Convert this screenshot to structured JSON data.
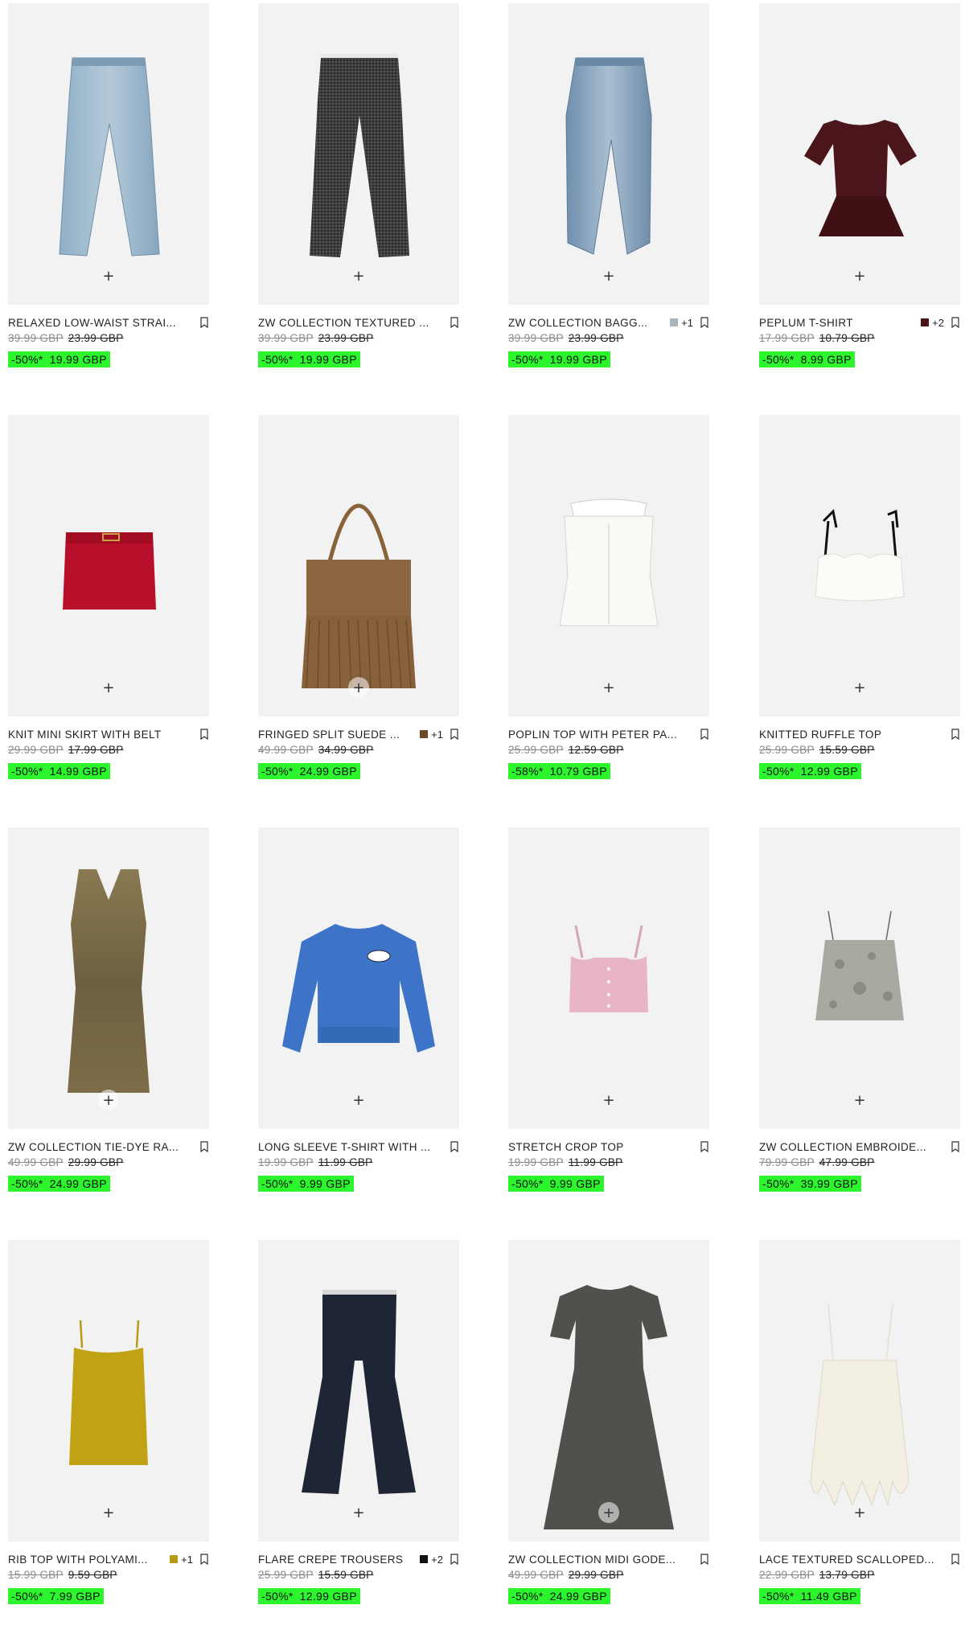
{
  "colors": {
    "sale_badge": "#2df52d",
    "image_bg": "#f2f2f2"
  },
  "products": [
    {
      "name": "RELAXED LOW-WAIST STRAIGHT-LEG JEANS",
      "display_name": "RELAXED LOW-WAIST STRAI...",
      "original_price": "39.99 GBP",
      "previous_price": "23.99 GBP",
      "discount": "-50%*",
      "sale_price": "19.99 GBP",
      "swatch_color": null,
      "more_colors": null,
      "add_icon": "plus-icon",
      "bookmark_icon": "bookmark-icon",
      "image": "light-wash-jeans"
    },
    {
      "name": "ZW COLLECTION TEXTURED TROUSERS",
      "display_name": "ZW COLLECTION TEXTURED ...",
      "original_price": "39.99 GBP",
      "previous_price": "23.99 GBP",
      "discount": "-50%*",
      "sale_price": "19.99 GBP",
      "swatch_color": null,
      "more_colors": null,
      "add_icon": "plus-icon",
      "bookmark_icon": "bookmark-icon",
      "image": "grey-textured-trousers"
    },
    {
      "name": "ZW COLLECTION BAGGY JEANS",
      "display_name": "ZW COLLECTION BAGG...",
      "original_price": "39.99 GBP",
      "previous_price": "23.99 GBP",
      "discount": "-50%*",
      "sale_price": "19.99 GBP",
      "swatch_color": "#a9b6bf",
      "more_colors": "+1",
      "add_icon": "plus-icon",
      "bookmark_icon": "bookmark-icon",
      "image": "baggy-jeans"
    },
    {
      "name": "PEPLUM T-SHIRT",
      "display_name": "PEPLUM T-SHIRT",
      "original_price": "17.99 GBP",
      "previous_price": "10.79 GBP",
      "discount": "-50%*",
      "sale_price": "8.99 GBP",
      "swatch_color": "#4a1418",
      "more_colors": "+2",
      "add_icon": "plus-icon",
      "bookmark_icon": "bookmark-icon",
      "image": "burgundy-peplum-tshirt"
    },
    {
      "name": "KNIT MINI SKIRT WITH BELT",
      "display_name": "KNIT MINI SKIRT WITH BELT",
      "original_price": "29.99 GBP",
      "previous_price": "17.99 GBP",
      "discount": "-50%*",
      "sale_price": "14.99 GBP",
      "swatch_color": null,
      "more_colors": null,
      "add_icon": "plus-icon",
      "bookmark_icon": "bookmark-icon",
      "image": "red-mini-skirt"
    },
    {
      "name": "FRINGED SPLIT SUEDE BAG",
      "display_name": "FRINGED SPLIT SUEDE ...",
      "original_price": "49.99 GBP",
      "previous_price": "34.99 GBP",
      "discount": "-50%*",
      "sale_price": "24.99 GBP",
      "swatch_color": "#6b4a2a",
      "more_colors": "+1",
      "add_icon": "plus-icon",
      "bookmark_icon": "bookmark-icon",
      "image": "fringed-suede-bag"
    },
    {
      "name": "POPLIN TOP WITH PETER PAN COLLAR",
      "display_name": "POPLIN TOP WITH PETER PA...",
      "original_price": "25.99 GBP",
      "previous_price": "12.59 GBP",
      "discount": "-58%*",
      "sale_price": "10.79 GBP",
      "swatch_color": null,
      "more_colors": null,
      "add_icon": "plus-icon",
      "bookmark_icon": "bookmark-icon",
      "image": "white-poplin-top"
    },
    {
      "name": "KNITTED RUFFLE TOP",
      "display_name": "KNITTED RUFFLE TOP",
      "original_price": "25.99 GBP",
      "previous_price": "15.59 GBP",
      "discount": "-50%*",
      "sale_price": "12.99 GBP",
      "swatch_color": null,
      "more_colors": null,
      "add_icon": "plus-icon",
      "bookmark_icon": "bookmark-icon",
      "image": "white-ruffle-top"
    },
    {
      "name": "ZW COLLECTION TIE-DYE RAYON DRESS",
      "display_name": "ZW COLLECTION TIE-DYE RA...",
      "original_price": "49.99 GBP",
      "previous_price": "29.99 GBP",
      "discount": "-50%*",
      "sale_price": "24.99 GBP",
      "swatch_color": null,
      "more_colors": null,
      "add_icon": "plus-icon",
      "bookmark_icon": "bookmark-icon",
      "image": "tie-dye-dress"
    },
    {
      "name": "LONG SLEEVE T-SHIRT WITH PRINT",
      "display_name": "LONG SLEEVE T-SHIRT WITH ...",
      "original_price": "19.99 GBP",
      "previous_price": "11.99 GBP",
      "discount": "-50%*",
      "sale_price": "9.99 GBP",
      "swatch_color": null,
      "more_colors": null,
      "add_icon": "plus-icon",
      "bookmark_icon": "bookmark-icon",
      "image": "blue-sweatshirt"
    },
    {
      "name": "STRETCH CROP TOP",
      "display_name": "STRETCH CROP TOP",
      "original_price": "19.99 GBP",
      "previous_price": "11.99 GBP",
      "discount": "-50%*",
      "sale_price": "9.99 GBP",
      "swatch_color": null,
      "more_colors": null,
      "add_icon": "plus-icon",
      "bookmark_icon": "bookmark-icon",
      "image": "pink-crop-top"
    },
    {
      "name": "ZW COLLECTION EMBROIDERED TOP",
      "display_name": "ZW COLLECTION EMBROIDE...",
      "original_price": "79.99 GBP",
      "previous_price": "47.99 GBP",
      "discount": "-50%*",
      "sale_price": "39.99 GBP",
      "swatch_color": null,
      "more_colors": null,
      "add_icon": "plus-icon",
      "bookmark_icon": "bookmark-icon",
      "image": "embroidered-cami"
    },
    {
      "name": "RIB TOP WITH POLYAMIDE",
      "display_name": "RIB TOP WITH POLYAMI...",
      "original_price": "15.99 GBP",
      "previous_price": "9.59 GBP",
      "discount": "-50%*",
      "sale_price": "7.99 GBP",
      "swatch_color": "#b89a14",
      "more_colors": "+1",
      "add_icon": "plus-icon",
      "bookmark_icon": "bookmark-icon",
      "image": "mustard-rib-top"
    },
    {
      "name": "FLARE CREPE TROUSERS",
      "display_name": "FLARE CREPE TROUSERS",
      "original_price": "25.99 GBP",
      "previous_price": "15.59 GBP",
      "discount": "-50%*",
      "sale_price": "12.99 GBP",
      "swatch_color": "#111111",
      "more_colors": "+2",
      "add_icon": "plus-icon",
      "bookmark_icon": "bookmark-icon",
      "image": "navy-flare-trousers"
    },
    {
      "name": "ZW COLLECTION MIDI GODET DRESS",
      "display_name": "ZW COLLECTION MIDI GODE...",
      "original_price": "49.99 GBP",
      "previous_price": "29.99 GBP",
      "discount": "-50%*",
      "sale_price": "24.99 GBP",
      "swatch_color": null,
      "more_colors": null,
      "add_icon": "plus-icon",
      "bookmark_icon": "bookmark-icon",
      "image": "grey-midi-dress"
    },
    {
      "name": "LACE TEXTURED SCALLOPED TOP",
      "display_name": "LACE TEXTURED SCALLOPED...",
      "original_price": "22.99 GBP",
      "previous_price": "13.79 GBP",
      "discount": "-50%*",
      "sale_price": "11.49 GBP",
      "swatch_color": null,
      "more_colors": null,
      "add_icon": "plus-icon",
      "bookmark_icon": "bookmark-icon",
      "image": "lace-top"
    }
  ]
}
